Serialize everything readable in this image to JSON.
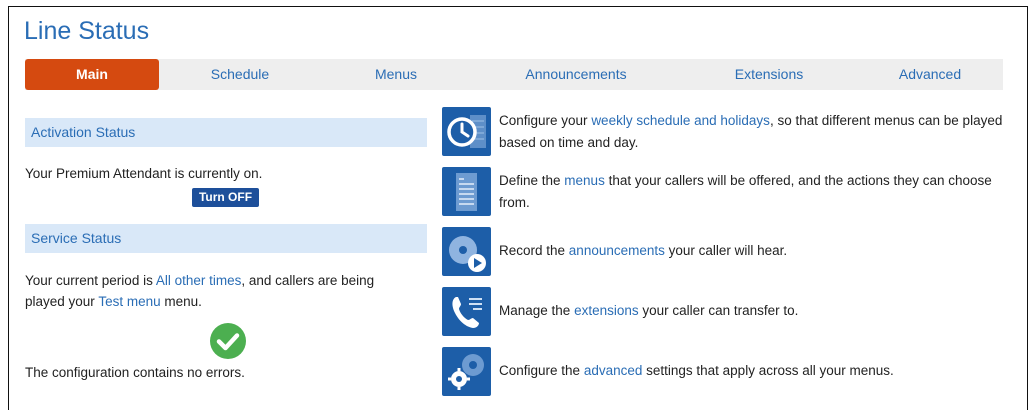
{
  "title": "Line Status",
  "tabs": [
    {
      "label": "Main",
      "active": true
    },
    {
      "label": "Schedule",
      "active": false
    },
    {
      "label": "Menus",
      "active": false
    },
    {
      "label": "Announcements",
      "active": false
    },
    {
      "label": "Extensions",
      "active": false
    },
    {
      "label": "Advanced",
      "active": false
    }
  ],
  "activation": {
    "heading": "Activation Status",
    "status_text": "Your Premium Attendant is currently on.",
    "button_label": "Turn OFF"
  },
  "service": {
    "heading": "Service Status",
    "period_prefix": "Your current period is ",
    "period_link": "All other times",
    "period_mid": ", and callers are being",
    "played_prefix": "played your ",
    "menu_link": "Test menu",
    "played_suffix": " menu.",
    "config_text": "The configuration contains no errors."
  },
  "features": [
    {
      "icon": "clock-calendar-icon",
      "prefix": "Configure your ",
      "link": "weekly schedule and holidays",
      "suffix": ", so that different menus can be played based on time and day."
    },
    {
      "icon": "menu-list-icon",
      "prefix": "Define the ",
      "link": "menus",
      "suffix": " that your callers will be offered, and the actions they can choose from."
    },
    {
      "icon": "disc-play-icon",
      "prefix": "Record the ",
      "link": "announcements",
      "suffix": " your caller will hear."
    },
    {
      "icon": "phone-extensions-icon",
      "prefix": "Manage the ",
      "link": "extensions",
      "suffix": " your caller can transfer to."
    },
    {
      "icon": "gears-icon",
      "prefix": "Configure the ",
      "link": "advanced",
      "suffix": " settings that apply across all your menus."
    }
  ],
  "colors": {
    "accent": "#2a6db5",
    "active_tab": "#d54a10",
    "section_bg": "#d9e8f8",
    "icon_bg": "#1d5ea8",
    "success": "#4caf50"
  }
}
